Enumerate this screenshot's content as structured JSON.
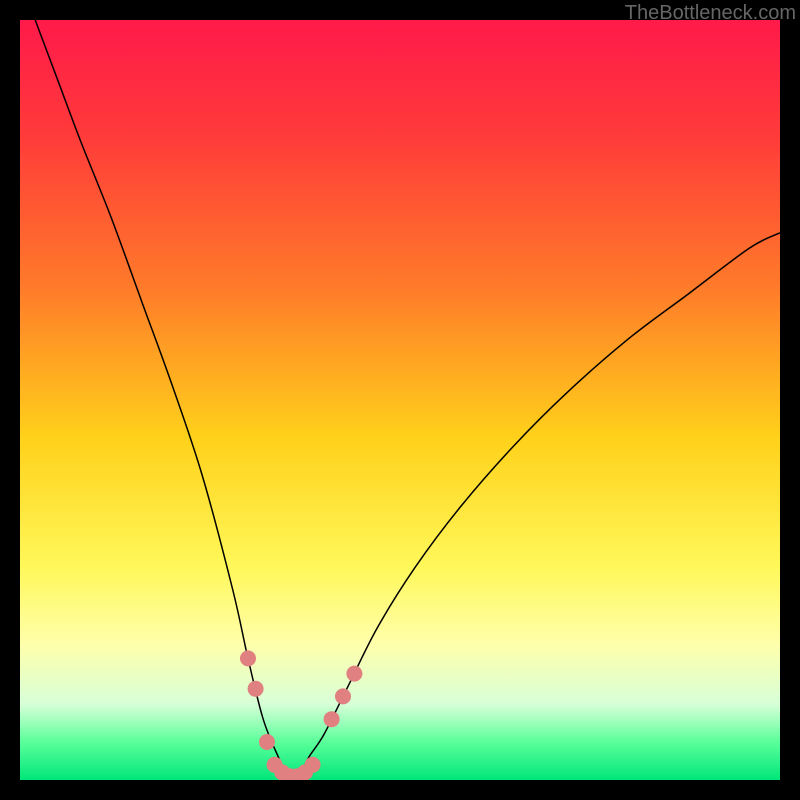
{
  "watermark": "TheBottleneck.com",
  "chart_data": {
    "type": "line",
    "title": "",
    "xlabel": "",
    "ylabel": "",
    "xlim": [
      0,
      100
    ],
    "ylim": [
      0,
      100
    ],
    "background_gradient": {
      "stops": [
        {
          "offset": 0.0,
          "color": "#ff1a4a"
        },
        {
          "offset": 0.15,
          "color": "#ff3a3a"
        },
        {
          "offset": 0.35,
          "color": "#ff7a2a"
        },
        {
          "offset": 0.55,
          "color": "#ffd11a"
        },
        {
          "offset": 0.72,
          "color": "#fff85a"
        },
        {
          "offset": 0.82,
          "color": "#ffffaa"
        },
        {
          "offset": 0.9,
          "color": "#d8ffd8"
        },
        {
          "offset": 0.95,
          "color": "#5aff9a"
        },
        {
          "offset": 1.0,
          "color": "#00e67a"
        }
      ]
    },
    "series": [
      {
        "name": "bottleneck-curve",
        "color": "#000000",
        "stroke_width": 1.5,
        "x": [
          2,
          5,
          8,
          12,
          16,
          20,
          24,
          28,
          30,
          32,
          34,
          35,
          36,
          37,
          38,
          40,
          43,
          47,
          52,
          58,
          65,
          72,
          80,
          88,
          96,
          100
        ],
        "y": [
          100,
          92,
          84,
          74,
          63,
          52,
          40,
          25,
          16,
          8,
          3,
          1,
          0.5,
          1,
          3,
          6,
          12,
          20,
          28,
          36,
          44,
          51,
          58,
          64,
          70,
          72
        ]
      }
    ],
    "markers": {
      "name": "highlight-points",
      "shape": "circle",
      "color": "#e08080",
      "radius": 8,
      "points": [
        {
          "x": 30,
          "y": 16
        },
        {
          "x": 31,
          "y": 12
        },
        {
          "x": 32.5,
          "y": 5
        },
        {
          "x": 33.5,
          "y": 2
        },
        {
          "x": 34.5,
          "y": 1
        },
        {
          "x": 35.5,
          "y": 0.5
        },
        {
          "x": 36.5,
          "y": 0.5
        },
        {
          "x": 37.5,
          "y": 1
        },
        {
          "x": 38.5,
          "y": 2
        },
        {
          "x": 41,
          "y": 8
        },
        {
          "x": 42.5,
          "y": 11
        },
        {
          "x": 44,
          "y": 14
        }
      ]
    }
  }
}
